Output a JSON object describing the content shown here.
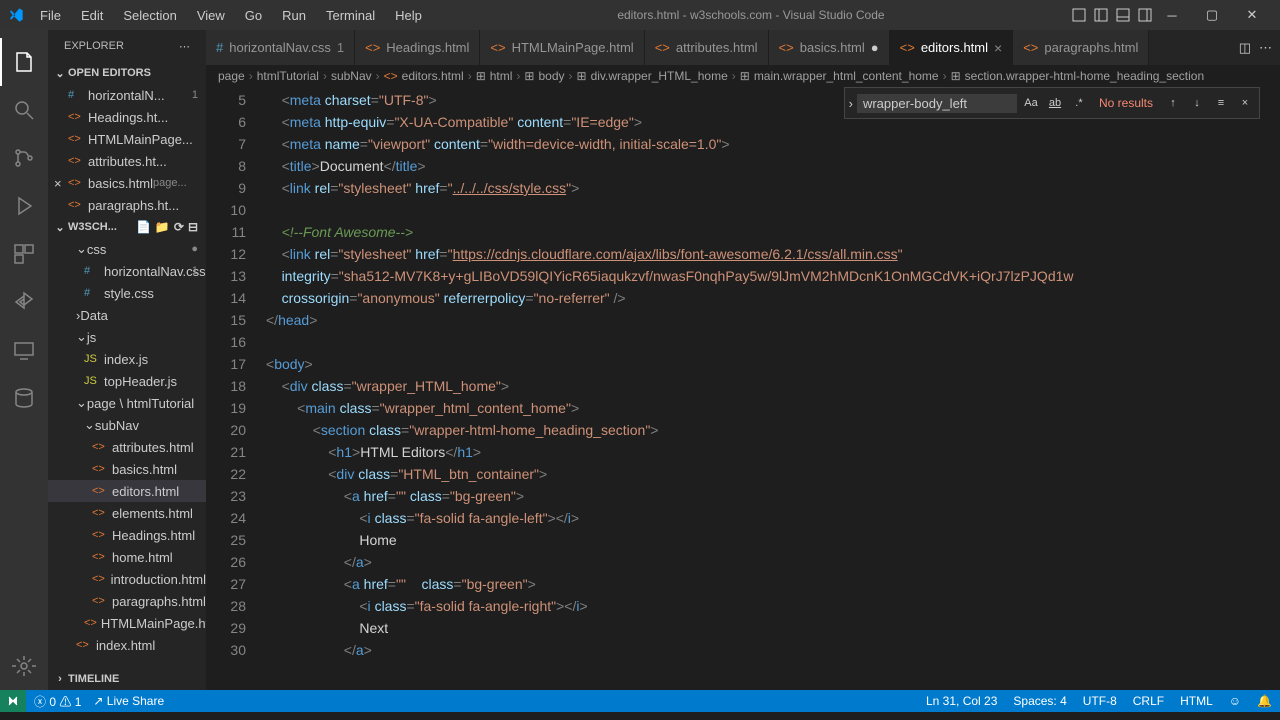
{
  "title": "editors.html - w3schools.com - Visual Studio Code",
  "menu": [
    "File",
    "Edit",
    "Selection",
    "View",
    "Go",
    "Run",
    "Terminal",
    "Help"
  ],
  "explorer": {
    "title": "EXPLORER",
    "open_editors": "OPEN EDITORS",
    "open_items": [
      {
        "name": "horizontalN...",
        "mod": "1"
      },
      {
        "name": "Headings.ht..."
      },
      {
        "name": "HTMLMainPage..."
      },
      {
        "name": "attributes.ht..."
      },
      {
        "name": "basics.html",
        "path": "page...",
        "dirty": true
      },
      {
        "name": "paragraphs.ht..."
      }
    ],
    "project": "W3SCH...",
    "tree": {
      "css": "css",
      "horizontalNav": "horizontalNav.css",
      "horizontalNav_mod": "1",
      "stylecss": "style.css",
      "data": "Data",
      "js": "js",
      "indexjs": "index.js",
      "topheader": "topHeader.js",
      "pagehtml": "page \\ htmlTutorial",
      "subnav": "subNav",
      "files": [
        "attributes.html",
        "basics.html",
        "editors.html",
        "elements.html",
        "Headings.html",
        "home.html",
        "introduction.html",
        "paragraphs.html",
        "HTMLMainPage.html"
      ],
      "indexhtml": "index.html"
    },
    "timeline": "TIMELINE"
  },
  "tabs": [
    {
      "name": "horizontalNav.css",
      "mod": "1"
    },
    {
      "name": "Headings.html"
    },
    {
      "name": "HTMLMainPage.html"
    },
    {
      "name": "attributes.html"
    },
    {
      "name": "basics.html",
      "dirty": true
    },
    {
      "name": "editors.html",
      "active": true
    },
    {
      "name": "paragraphs.html"
    }
  ],
  "breadcrumb": [
    "page",
    "htmlTutorial",
    "subNav",
    "editors.html",
    "html",
    "body",
    "div.wrapper_HTML_home",
    "main.wrapper_html_content_home",
    "section.wrapper-html-home_heading_section"
  ],
  "find": {
    "value": "wrapper-body_left",
    "results": "No results"
  },
  "line_start": 5,
  "statusbar": {
    "errors": "0",
    "warnings": "1",
    "liveshare": "Live Share",
    "cursor": "Ln 31, Col 23",
    "spaces": "Spaces: 4",
    "encoding": "UTF-8",
    "eol": "CRLF",
    "lang": "HTML"
  }
}
